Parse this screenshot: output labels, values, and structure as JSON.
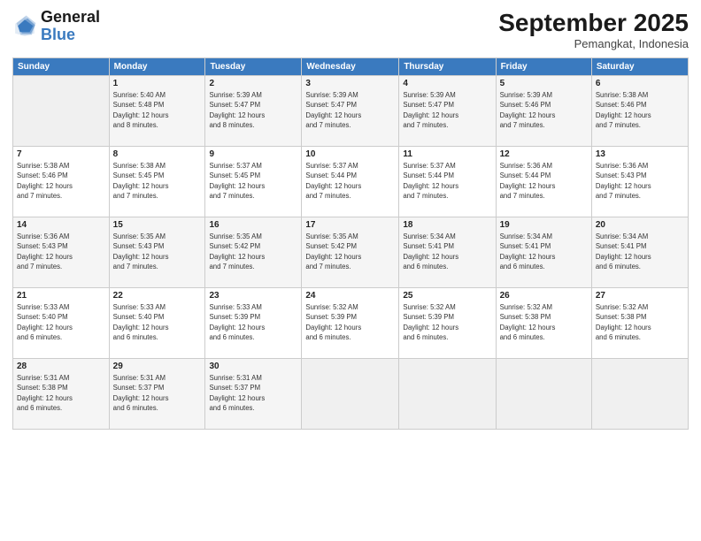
{
  "header": {
    "logo_general": "General",
    "logo_blue": "Blue",
    "month": "September 2025",
    "location": "Pemangkat, Indonesia"
  },
  "days_of_week": [
    "Sunday",
    "Monday",
    "Tuesday",
    "Wednesday",
    "Thursday",
    "Friday",
    "Saturday"
  ],
  "weeks": [
    [
      {
        "day": "",
        "info": ""
      },
      {
        "day": "1",
        "info": "Sunrise: 5:40 AM\nSunset: 5:48 PM\nDaylight: 12 hours\nand 8 minutes."
      },
      {
        "day": "2",
        "info": "Sunrise: 5:39 AM\nSunset: 5:47 PM\nDaylight: 12 hours\nand 8 minutes."
      },
      {
        "day": "3",
        "info": "Sunrise: 5:39 AM\nSunset: 5:47 PM\nDaylight: 12 hours\nand 7 minutes."
      },
      {
        "day": "4",
        "info": "Sunrise: 5:39 AM\nSunset: 5:47 PM\nDaylight: 12 hours\nand 7 minutes."
      },
      {
        "day": "5",
        "info": "Sunrise: 5:39 AM\nSunset: 5:46 PM\nDaylight: 12 hours\nand 7 minutes."
      },
      {
        "day": "6",
        "info": "Sunrise: 5:38 AM\nSunset: 5:46 PM\nDaylight: 12 hours\nand 7 minutes."
      }
    ],
    [
      {
        "day": "7",
        "info": "Sunrise: 5:38 AM\nSunset: 5:46 PM\nDaylight: 12 hours\nand 7 minutes."
      },
      {
        "day": "8",
        "info": "Sunrise: 5:38 AM\nSunset: 5:45 PM\nDaylight: 12 hours\nand 7 minutes."
      },
      {
        "day": "9",
        "info": "Sunrise: 5:37 AM\nSunset: 5:45 PM\nDaylight: 12 hours\nand 7 minutes."
      },
      {
        "day": "10",
        "info": "Sunrise: 5:37 AM\nSunset: 5:44 PM\nDaylight: 12 hours\nand 7 minutes."
      },
      {
        "day": "11",
        "info": "Sunrise: 5:37 AM\nSunset: 5:44 PM\nDaylight: 12 hours\nand 7 minutes."
      },
      {
        "day": "12",
        "info": "Sunrise: 5:36 AM\nSunset: 5:44 PM\nDaylight: 12 hours\nand 7 minutes."
      },
      {
        "day": "13",
        "info": "Sunrise: 5:36 AM\nSunset: 5:43 PM\nDaylight: 12 hours\nand 7 minutes."
      }
    ],
    [
      {
        "day": "14",
        "info": "Sunrise: 5:36 AM\nSunset: 5:43 PM\nDaylight: 12 hours\nand 7 minutes."
      },
      {
        "day": "15",
        "info": "Sunrise: 5:35 AM\nSunset: 5:43 PM\nDaylight: 12 hours\nand 7 minutes."
      },
      {
        "day": "16",
        "info": "Sunrise: 5:35 AM\nSunset: 5:42 PM\nDaylight: 12 hours\nand 7 minutes."
      },
      {
        "day": "17",
        "info": "Sunrise: 5:35 AM\nSunset: 5:42 PM\nDaylight: 12 hours\nand 7 minutes."
      },
      {
        "day": "18",
        "info": "Sunrise: 5:34 AM\nSunset: 5:41 PM\nDaylight: 12 hours\nand 6 minutes."
      },
      {
        "day": "19",
        "info": "Sunrise: 5:34 AM\nSunset: 5:41 PM\nDaylight: 12 hours\nand 6 minutes."
      },
      {
        "day": "20",
        "info": "Sunrise: 5:34 AM\nSunset: 5:41 PM\nDaylight: 12 hours\nand 6 minutes."
      }
    ],
    [
      {
        "day": "21",
        "info": "Sunrise: 5:33 AM\nSunset: 5:40 PM\nDaylight: 12 hours\nand 6 minutes."
      },
      {
        "day": "22",
        "info": "Sunrise: 5:33 AM\nSunset: 5:40 PM\nDaylight: 12 hours\nand 6 minutes."
      },
      {
        "day": "23",
        "info": "Sunrise: 5:33 AM\nSunset: 5:39 PM\nDaylight: 12 hours\nand 6 minutes."
      },
      {
        "day": "24",
        "info": "Sunrise: 5:32 AM\nSunset: 5:39 PM\nDaylight: 12 hours\nand 6 minutes."
      },
      {
        "day": "25",
        "info": "Sunrise: 5:32 AM\nSunset: 5:39 PM\nDaylight: 12 hours\nand 6 minutes."
      },
      {
        "day": "26",
        "info": "Sunrise: 5:32 AM\nSunset: 5:38 PM\nDaylight: 12 hours\nand 6 minutes."
      },
      {
        "day": "27",
        "info": "Sunrise: 5:32 AM\nSunset: 5:38 PM\nDaylight: 12 hours\nand 6 minutes."
      }
    ],
    [
      {
        "day": "28",
        "info": "Sunrise: 5:31 AM\nSunset: 5:38 PM\nDaylight: 12 hours\nand 6 minutes."
      },
      {
        "day": "29",
        "info": "Sunrise: 5:31 AM\nSunset: 5:37 PM\nDaylight: 12 hours\nand 6 minutes."
      },
      {
        "day": "30",
        "info": "Sunrise: 5:31 AM\nSunset: 5:37 PM\nDaylight: 12 hours\nand 6 minutes."
      },
      {
        "day": "",
        "info": ""
      },
      {
        "day": "",
        "info": ""
      },
      {
        "day": "",
        "info": ""
      },
      {
        "day": "",
        "info": ""
      }
    ]
  ]
}
